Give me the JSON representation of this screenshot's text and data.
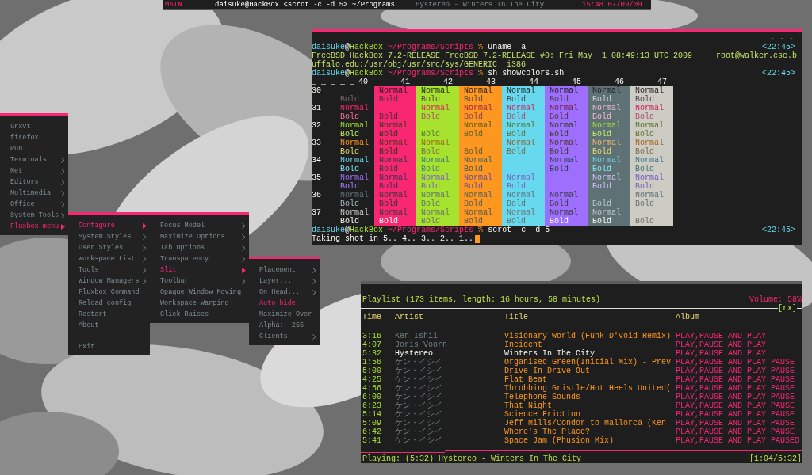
{
  "status_bar": {
    "workspace": "MAIN",
    "window_title": "daisuke@HackBox <scrot -c -d 5> ~/Programs",
    "now_playing": "Hystereo - Winters In The City",
    "clock": "15:48 07/09/09"
  },
  "terminal": {
    "controls": "- - -",
    "lines": [
      {
        "kind": "prompt",
        "user": "daisuke",
        "at": "@",
        "host": "HackBox",
        "path": "~/Programs/Scripts",
        "sign": "%",
        "command": "uname -a",
        "time": "<22:45>"
      },
      {
        "kind": "output",
        "text": "FreeBSD HackBox 7.2-RELEASE FreeBSD 7.2-RELEASE #0: Fri May  1 08:49:13 UTC 2009     root@walker.cse.b"
      },
      {
        "kind": "output",
        "text": "uffalo.edu:/usr/obj/usr/src/sys/GENERIC  i386"
      },
      {
        "kind": "prompt",
        "user": "daisuke",
        "at": "@",
        "host": "HackBox",
        "path": "~/Programs/Scripts",
        "sign": "%",
        "command": "sh showcolors.sh",
        "time": "<22:45>"
      },
      {
        "kind": "table"
      },
      {
        "kind": "prompt",
        "user": "daisuke",
        "at": "@",
        "host": "HackBox",
        "path": "~/Programs/Scripts",
        "sign": "%",
        "command": "scrot -c -d 5",
        "time": "<22:45>"
      },
      {
        "kind": "cursor",
        "text": "Taking shot in 5.. 4.. 3.. 2.. 1.."
      }
    ],
    "color_table": {
      "lead": "_ _ _ _ _",
      "columns": [
        {
          "label": "40"
        },
        {
          "label": "41"
        },
        {
          "label": "42"
        },
        {
          "label": "43"
        },
        {
          "label": "44"
        },
        {
          "label": "45"
        },
        {
          "label": "46"
        },
        {
          "label": "47"
        }
      ],
      "rows": [
        {
          "label": "30",
          "cells": [
            {
              "bold": "Bold"
            },
            {
              "normal": "Normal",
              "bold": "Bold"
            },
            {
              "normal": "Normal",
              "bold": "Bold"
            },
            {
              "normal": "Normal",
              "bold": "Bold"
            },
            {
              "normal": "Normal",
              "bold": "Bold"
            },
            {
              "normal": "Normal",
              "bold": "Bold"
            },
            {
              "normal": "Normal",
              "bold": "Bold"
            },
            {
              "normal": "Normal",
              "bold": "Bold"
            }
          ]
        },
        {
          "label": "31",
          "cells": [
            {
              "normal": "Normal",
              "bold": "Bold"
            },
            {
              "bold": "Bold"
            },
            {
              "normal": "Normal",
              "bold": "Bold"
            },
            {
              "normal": "Normal",
              "bold": "Bold"
            },
            {
              "normal": "Normal",
              "bold": "Bold"
            },
            {
              "normal": "Normal",
              "bold": "Bold"
            },
            {
              "normal": "Normal",
              "bold": "Bold"
            },
            {
              "normal": "Normal",
              "bold": "Bold"
            }
          ]
        },
        {
          "label": "32",
          "cells": [
            {
              "normal": "Normal",
              "bold": "Bold"
            },
            {
              "normal": "Normal",
              "bold": "Bold"
            },
            {
              "bold": "Bold"
            },
            {
              "normal": "Normal",
              "bold": "Bold"
            },
            {
              "normal": "Normal",
              "bold": "Bold"
            },
            {
              "normal": "Normal",
              "bold": "Bold"
            },
            {
              "normal": "Normal",
              "bold": "Bold"
            },
            {
              "normal": "Normal",
              "bold": "Bold"
            }
          ]
        },
        {
          "label": "33",
          "cells": [
            {
              "normal": "Normal",
              "bold": "Bold"
            },
            {
              "normal": "Normal",
              "bold": "Bold"
            },
            {
              "normal": "Normal",
              "bold": "Bold"
            },
            {
              "bold": "Bold"
            },
            {
              "normal": "Normal",
              "bold": "Bold"
            },
            {
              "normal": "Normal",
              "bold": "Bold"
            },
            {
              "normal": "Normal",
              "bold": "Bold"
            },
            {
              "normal": "Normal",
              "bold": "Bold"
            }
          ]
        },
        {
          "label": "34",
          "cells": [
            {
              "normal": "Normal",
              "bold": "Bold"
            },
            {
              "normal": "Normal",
              "bold": "Bold"
            },
            {
              "normal": "Normal",
              "bold": "Bold"
            },
            {
              "normal": "Normal",
              "bold": "Bold"
            },
            {},
            {
              "normal": "Normal",
              "bold": "Bold"
            },
            {
              "normal": "Normal",
              "bold": "Bold"
            },
            {
              "normal": "Normal",
              "bold": "Bold"
            }
          ]
        },
        {
          "label": "35",
          "cells": [
            {
              "normal": "Normal",
              "bold": "Bold"
            },
            {
              "normal": "Normal",
              "bold": "Bold"
            },
            {
              "normal": "Normal",
              "bold": "Bold"
            },
            {
              "normal": "Normal",
              "bold": "Bold"
            },
            {
              "normal": "Normal",
              "bold": "Bold"
            },
            {},
            {
              "normal": "Normal",
              "bold": "Bold"
            },
            {
              "normal": "Normal",
              "bold": "Bold"
            }
          ]
        },
        {
          "label": "36",
          "cells": [
            {
              "normal": "Normal",
              "bold": "Bold"
            },
            {
              "normal": "Normal",
              "bold": "Bold"
            },
            {
              "normal": "Normal",
              "bold": "Bold"
            },
            {
              "normal": "Normal",
              "bold": "Bold"
            },
            {
              "normal": "Normal",
              "bold": "Bold"
            },
            {
              "normal": "Normal",
              "bold": "Bold"
            },
            {
              "bold": "Bold"
            },
            {
              "normal": "Normal",
              "bold": "Bold"
            }
          ]
        },
        {
          "label": "37",
          "cells": [
            {
              "normal": "Normal",
              "bold": "Bold"
            },
            {
              "normal": "Normal",
              "bold": "Bold"
            },
            {
              "normal": "Normal",
              "bold": "Bold"
            },
            {
              "normal": "Normal",
              "bold": "Bold"
            },
            {
              "normal": "Normal",
              "bold": "Bold"
            },
            {
              "normal": "Normal",
              "bold": "Bold"
            },
            {
              "normal": "Normal",
              "bold": "Bold"
            },
            {
              "bold": "Bold"
            }
          ]
        }
      ]
    }
  },
  "menus": [
    {
      "items": [
        {
          "kind": "item",
          "label": "urxvt",
          "submenu": false,
          "selected": false
        },
        {
          "kind": "item",
          "label": "firefox",
          "submenu": false,
          "selected": false
        },
        {
          "kind": "item",
          "label": "Run",
          "submenu": false,
          "selected": false
        },
        {
          "kind": "item",
          "label": "Terminals",
          "submenu": true,
          "selected": false
        },
        {
          "kind": "item",
          "label": "Net",
          "submenu": true,
          "selected": false
        },
        {
          "kind": "item",
          "label": "Editors",
          "submenu": true,
          "selected": false
        },
        {
          "kind": "item",
          "label": "Multimedia",
          "submenu": true,
          "selected": false
        },
        {
          "kind": "item",
          "label": "Office",
          "submenu": true,
          "selected": false
        },
        {
          "kind": "item",
          "label": "System Tools",
          "submenu": true,
          "selected": false
        },
        {
          "kind": "item",
          "label": "Fluxbox menu",
          "submenu": true,
          "selected": true
        }
      ]
    },
    {
      "items": [
        {
          "kind": "item",
          "label": "Configure",
          "submenu": true,
          "selected": true
        },
        {
          "kind": "item",
          "label": "System Styles",
          "submenu": true,
          "selected": false
        },
        {
          "kind": "item",
          "label": "User Styles",
          "submenu": true,
          "selected": false
        },
        {
          "kind": "item",
          "label": "Workspace List",
          "submenu": true,
          "selected": false
        },
        {
          "kind": "item",
          "label": "Tools",
          "submenu": true,
          "selected": false
        },
        {
          "kind": "item",
          "label": "Window Managers",
          "submenu": true,
          "selected": false
        },
        {
          "kind": "item",
          "label": "Fluxbox Command",
          "submenu": false,
          "selected": false
        },
        {
          "kind": "item",
          "label": "Reload config",
          "submenu": false,
          "selected": false
        },
        {
          "kind": "item",
          "label": "Restart",
          "submenu": false,
          "selected": false
        },
        {
          "kind": "item",
          "label": "About",
          "submenu": false,
          "selected": false
        },
        {
          "kind": "separator"
        },
        {
          "kind": "item",
          "label": "Exit",
          "submenu": false,
          "selected": false
        }
      ]
    },
    {
      "items": [
        {
          "kind": "item",
          "label": "Focus Model",
          "submenu": true,
          "selected": false
        },
        {
          "kind": "item",
          "label": "Maximize Options",
          "submenu": true,
          "selected": false
        },
        {
          "kind": "item",
          "label": "Tab Options",
          "submenu": true,
          "selected": false
        },
        {
          "kind": "item",
          "label": "Transparency",
          "submenu": true,
          "selected": false
        },
        {
          "kind": "item",
          "label": "Slit",
          "submenu": true,
          "selected": true
        },
        {
          "kind": "item",
          "label": "Toolbar",
          "submenu": true,
          "selected": false
        },
        {
          "kind": "item",
          "label": "Opaque Window Moving",
          "submenu": false,
          "selected": false
        },
        {
          "kind": "item",
          "label": "Workspace Warping",
          "submenu": false,
          "selected": false
        },
        {
          "kind": "item",
          "label": "Click Raises",
          "submenu": false,
          "selected": false
        }
      ]
    },
    {
      "items": [
        {
          "kind": "item",
          "label": "Placement",
          "submenu": true,
          "selected": false
        },
        {
          "kind": "item",
          "label": "Layer...",
          "submenu": true,
          "selected": false
        },
        {
          "kind": "item",
          "label": "On Head...",
          "submenu": true,
          "selected": false
        },
        {
          "kind": "item",
          "label": "Auto hide",
          "submenu": false,
          "selected": true
        },
        {
          "kind": "item",
          "label": "Maximize Over",
          "submenu": false,
          "selected": false
        },
        {
          "kind": "item",
          "label": "Alpha:  255",
          "submenu": false,
          "selected": false
        },
        {
          "kind": "item",
          "label": "Clients",
          "submenu": true,
          "selected": false
        }
      ]
    }
  ],
  "player": {
    "summary": "Playlist (173 items, length: 16 hours, 58 minutes)",
    "volume": "Volume: 58%",
    "mode": "[rx]",
    "columns": [
      "Time",
      "Artist",
      "Title",
      "Album"
    ],
    "rows": [
      {
        "time": "3:16",
        "artist": "Ken Ishii",
        "title": "Visionary World (Funk D'Void Remix)",
        "album": "PLAY,PAUSE AND PLAY",
        "playing": false
      },
      {
        "time": "4:07",
        "artist": "Joris Voorn",
        "title": "Incident",
        "album": "PLAY,PAUSE AND PLAY",
        "playing": false
      },
      {
        "time": "5:32",
        "artist": "Hystereo",
        "title": "Winters In The City",
        "album": "PLAY,PAUSE AND PLAY",
        "playing": true
      },
      {
        "time": "1:56",
        "artist": "ケン・イシイ",
        "title": "Organised Green(Initial Mix) - Prev",
        "album": "PLAY,PAUSE AND PLAY PAUSE",
        "playing": false
      },
      {
        "time": "5:00",
        "artist": "ケン・イシイ",
        "title": "Drive In Drive Out",
        "album": "PLAY,PAUSE AND PLAY PAUSE",
        "playing": false
      },
      {
        "time": "4:25",
        "artist": "ケン・イシイ",
        "title": "Flat Beat",
        "album": "PLAY,PAUSE AND PLAY PAUSE",
        "playing": false
      },
      {
        "time": "4:56",
        "artist": "ケン・イシイ",
        "title": "Throbbing Gristle/Hot Heels United(",
        "album": "PLAY,PAUSE AND PLAY PAUSE",
        "playing": false
      },
      {
        "time": "6:00",
        "artist": "ケン・イシイ",
        "title": "Telephone Sounds",
        "album": "PLAY,PAUSE AND PLAY PAUSE",
        "playing": false
      },
      {
        "time": "6:23",
        "artist": "ケン・イシイ",
        "title": "That Night",
        "album": "PLAY,PAUSE AND PLAY PAUSE",
        "playing": false
      },
      {
        "time": "5:14",
        "artist": "ケン・イシイ",
        "title": "Science Friction",
        "album": "PLAY,PAUSE AND PLAY PAUSE",
        "playing": false
      },
      {
        "time": "5:09",
        "artist": "ケン・イシイ",
        "title": "Jeff Mills/Condor to Mallorca (Ken",
        "album": "PLAY,PAUSE AND PLAY PAUSE",
        "playing": false
      },
      {
        "time": "6:42",
        "artist": "ケン・イシイ",
        "title": "Where's The Place?",
        "album": "PLAY,PAUSE AND PLAY PAUSE",
        "playing": false
      },
      {
        "time": "5:41",
        "artist": "ケン・イシイ",
        "title": "Space Jam (Phusion Mix)",
        "album": "PLAY,PAUSE AND PLAY PAUSED",
        "playing": false
      }
    ],
    "progress": {
      "level": 0.19
    },
    "status": "Playing: (5:32) Hystereo - Winters In The City",
    "elapsed": "[1:04/5:32]"
  }
}
